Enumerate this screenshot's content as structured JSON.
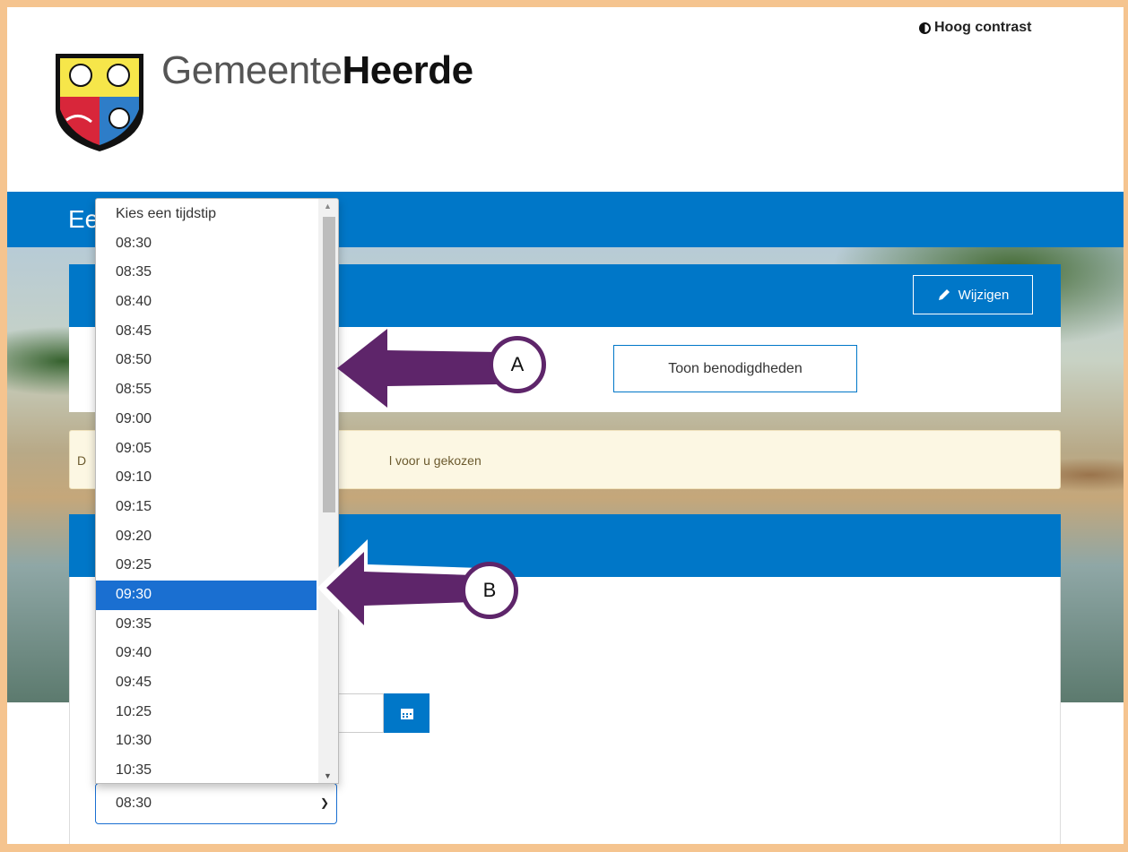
{
  "header": {
    "contrast_label": "Hoog contrast",
    "brand_light": "Gemeente",
    "brand_bold": "Heerde"
  },
  "banner": {
    "title_fragment": "Ee"
  },
  "card1": {
    "edit_label": "Wijzigen",
    "show_label": "Toon benodigdheden"
  },
  "notice": {
    "prefix": "D",
    "text": "l voor u gekozen"
  },
  "time_select": {
    "value": "08:30",
    "options": [
      "Kies een tijdstip",
      "08:30",
      "08:35",
      "08:40",
      "08:45",
      "08:50",
      "08:55",
      "09:00",
      "09:05",
      "09:10",
      "09:15",
      "09:20",
      "09:25",
      "09:30",
      "09:35",
      "09:40",
      "09:45",
      "10:25",
      "10:30",
      "10:35"
    ],
    "highlighted": "09:30"
  },
  "annotations": {
    "a": "A",
    "b": "B"
  },
  "colors": {
    "blue": "#0077c8",
    "select_blue": "#1a6fd1",
    "arrow_purple": "#5e256a",
    "frame": "#f5c48f"
  }
}
